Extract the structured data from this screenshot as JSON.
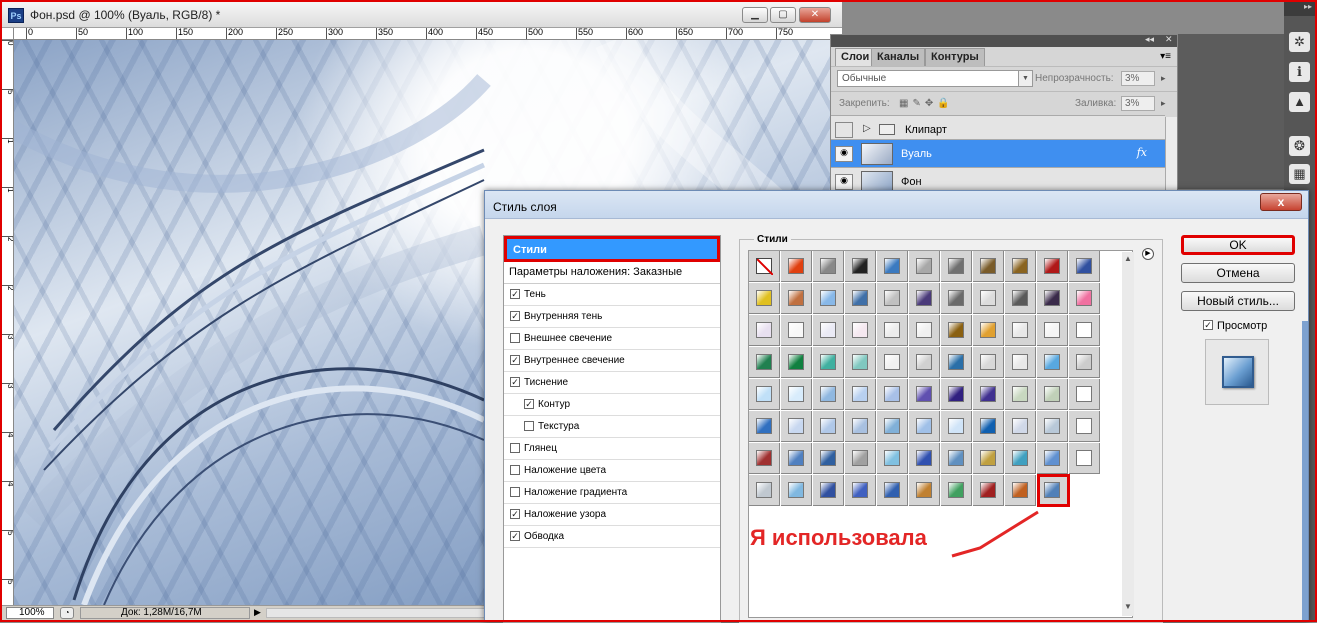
{
  "document": {
    "title": "Фон.psd @ 100% (Вуаль, RGB/8) *",
    "app_icon": "Ps",
    "ruler_h": [
      "0",
      "50",
      "100",
      "150",
      "200",
      "250",
      "300",
      "350",
      "400",
      "450",
      "500",
      "550",
      "600",
      "650",
      "700",
      "750"
    ],
    "ruler_v": [
      "0",
      "5",
      "1",
      "1",
      "2",
      "2",
      "3",
      "3",
      "4",
      "4",
      "5",
      "5"
    ],
    "zoom": "100%",
    "doc_info": "Док: 1,28М/16,7М"
  },
  "layers_panel": {
    "tabs": [
      "Слои",
      "Каналы",
      "Контуры"
    ],
    "blend_mode": "Обычные",
    "opacity_label": "Непрозрачность:",
    "opacity_value": "3%",
    "lock_label": "Закрепить:",
    "fill_label": "Заливка:",
    "fill_value": "3%",
    "layers": [
      {
        "name": "Клипарт",
        "type": "group"
      },
      {
        "name": "Вуаль",
        "type": "layer",
        "selected": true,
        "fx": "fx"
      },
      {
        "name": "Фон",
        "type": "layer"
      }
    ]
  },
  "dialog": {
    "title": "Стиль слоя",
    "close": "x",
    "left_header": "Стили",
    "blending_options": "Параметры наложения: Заказные",
    "effects": [
      {
        "label": "Тень",
        "checked": true,
        "indent": false
      },
      {
        "label": "Внутренняя тень",
        "checked": true,
        "indent": false
      },
      {
        "label": "Внешнее свечение",
        "checked": false,
        "indent": false
      },
      {
        "label": "Внутреннее свечение",
        "checked": true,
        "indent": false
      },
      {
        "label": "Тиснение",
        "checked": true,
        "indent": false
      },
      {
        "label": "Контур",
        "checked": true,
        "indent": true
      },
      {
        "label": "Текстура",
        "checked": false,
        "indent": true
      },
      {
        "label": "Глянец",
        "checked": false,
        "indent": false
      },
      {
        "label": "Наложение цвета",
        "checked": false,
        "indent": false
      },
      {
        "label": "Наложение градиента",
        "checked": false,
        "indent": false
      },
      {
        "label": "Наложение узора",
        "checked": true,
        "indent": false
      },
      {
        "label": "Обводка",
        "checked": true,
        "indent": false
      }
    ],
    "styles_group_label": "Стили",
    "swatch_colors": [
      [
        "none",
        "#e04010",
        "#888888",
        "#222222",
        "#3b7ac0",
        "#a8a8a8",
        "#707070",
        "#7a5c2a",
        "#8a6420",
        "#b01818",
        "#3050a0"
      ],
      [
        "#e0c020",
        "#c07040",
        "#88b8e8",
        "#4070a8",
        "#c0c0c0",
        "#4a3a7a",
        "#6a6a6a",
        "#dcdcdc",
        "#5a5a5a",
        "#3a2a4a",
        "#f070a0"
      ],
      [
        "#e8e0f0",
        "#f8f8f8",
        "#eaeaf5",
        "#f5e8f0",
        "#ececec",
        "#f0f0f0",
        "#8a6010",
        "#e0a030",
        "#e8e8e8",
        "#f4f4f4",
        "#ffffff"
      ],
      [
        "#208050",
        "#108040",
        "#40b0a0",
        "#80c8c0",
        "#f0f0f0",
        "#d0d0d0",
        "#2a6fa8",
        "#d8d8d8",
        "#e8e8e8",
        "#58a8e0",
        "#cccccc"
      ],
      [
        "#c0e0f8",
        "#d8ecfc",
        "#90b8e0",
        "#b8d0f0",
        "#a8c0e8",
        "#6050b0",
        "#302080",
        "#403090",
        "#c8d8c0",
        "#c0d0b8",
        "#ffffff"
      ],
      [
        "#3070c0",
        "#c8d8f0",
        "#b0c8e8",
        "#a8c0e0",
        "#80b0d8",
        "#a0c0e8",
        "#d0e4f8",
        "#1060b0",
        "#d0d8e8",
        "#b8c8d8",
        "#ffffff"
      ],
      [
        "#a03030",
        "#5080c0",
        "#3060a0",
        "#a0a0a0",
        "#80c0e0",
        "#3050b0",
        "#6090c0",
        "#c0a040",
        "#40a0c0",
        "#6090d0",
        "#ffffff"
      ],
      [
        "#c0c8d0",
        "#80b8e0",
        "#3050a0",
        "#4060c0",
        "#3060b0",
        "#c08030",
        "#40a060",
        "#a02020",
        "#c06020",
        "#5080b8",
        "#ffffff"
      ]
    ],
    "used_annotation": "Я использовала",
    "buttons": {
      "ok": "OK",
      "cancel": "Отмена",
      "new_style": "Новый стиль..."
    },
    "preview_label": "Просмотр",
    "preview_checked": true
  },
  "annotation_color": "#e00000"
}
